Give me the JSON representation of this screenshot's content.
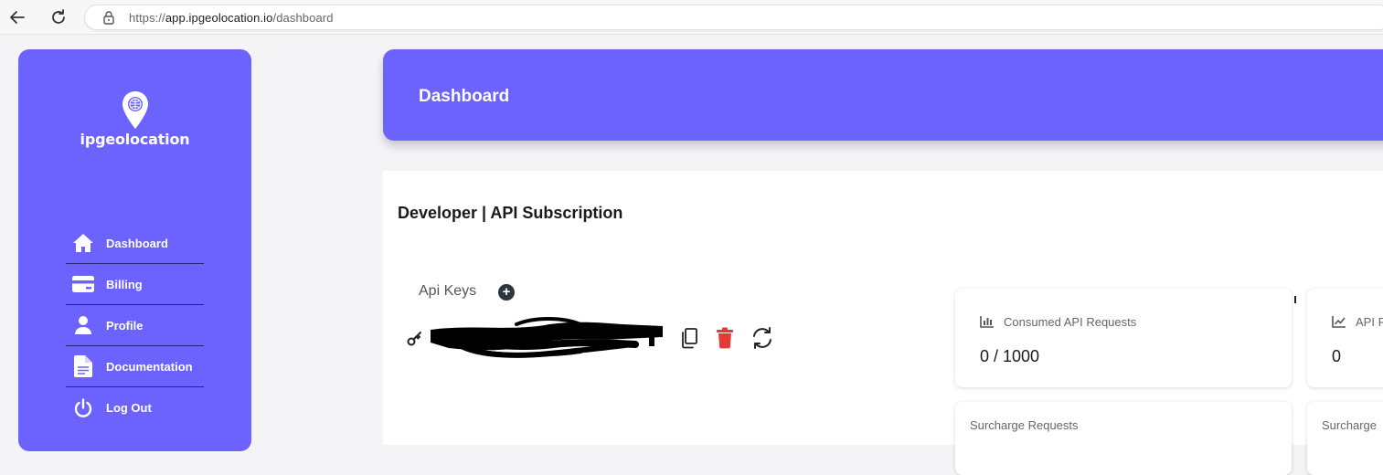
{
  "browser": {
    "url_prefix": "https://",
    "url_host": "app.ipgeolocation.io",
    "url_path": "/dashboard"
  },
  "sidebar": {
    "logo_text": "ipgeolocation",
    "items": [
      {
        "label": "Dashboard",
        "icon": "home-icon"
      },
      {
        "label": "Billing",
        "icon": "credit-card-icon"
      },
      {
        "label": "Profile",
        "icon": "user-icon"
      },
      {
        "label": "Documentation",
        "icon": "document-icon"
      },
      {
        "label": "Log Out",
        "icon": "power-icon"
      }
    ]
  },
  "header": {
    "title": "Dashboard"
  },
  "main": {
    "subscription_title": "Developer | API Subscription",
    "api_keys_label": "Api Keys",
    "add_symbol": "+",
    "stats": [
      {
        "label": "Consumed API Requests",
        "value": "0 / 1000",
        "icon": "bar-chart-icon"
      },
      {
        "label": "API R",
        "value": "0",
        "icon": "line-chart-icon"
      }
    ],
    "bottom_stats": [
      {
        "label": "Surcharge Requests"
      },
      {
        "label": "Surcharge"
      }
    ]
  },
  "colors": {
    "primary": "#6c63ff",
    "delete": "#e53935",
    "divider": "#27227a"
  }
}
